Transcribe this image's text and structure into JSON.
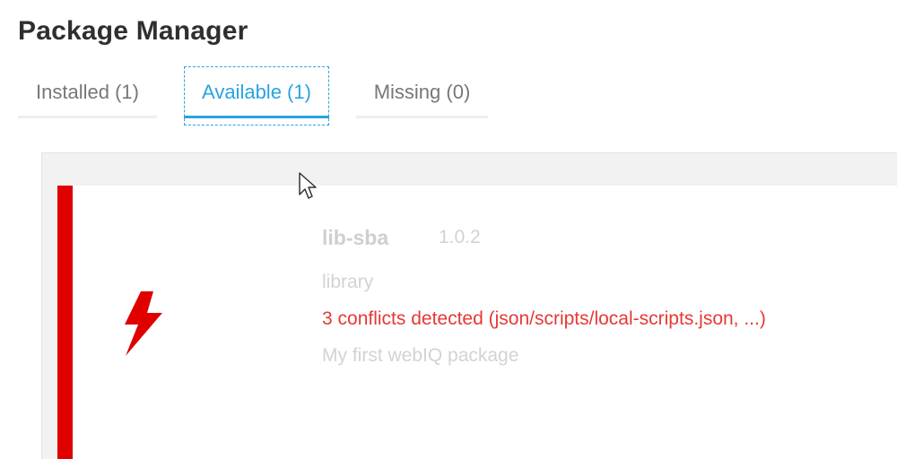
{
  "page": {
    "title": "Package Manager"
  },
  "tabs": [
    {
      "label": "Installed (1)",
      "active": false
    },
    {
      "label": "Available (1)",
      "active": true
    },
    {
      "label": "Missing (0)",
      "active": false
    }
  ],
  "package": {
    "name": "lib-sba",
    "version": "1.0.2",
    "type": "library",
    "conflicts": "3 conflicts detected (json/scripts/local-scripts.json, ...)",
    "description": "My first webIQ package",
    "status_icon": "lightning-bolt-icon"
  },
  "colors": {
    "accent": "#2aa3e0",
    "conflict": "#e00000",
    "conflict_text": "#e53935"
  }
}
